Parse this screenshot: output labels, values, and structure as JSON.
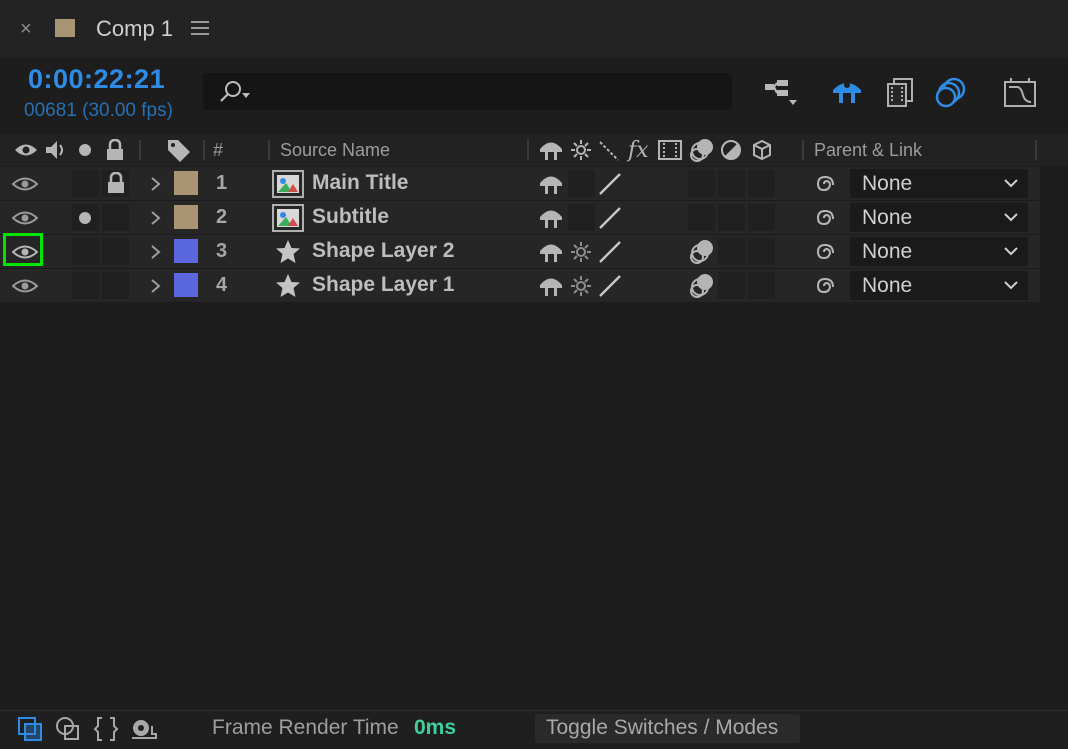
{
  "tab": {
    "close": "×",
    "title": "Comp 1"
  },
  "header": {
    "timecode": "0:00:22:21",
    "frames": "00681 (30.00 fps)",
    "search_placeholder": ""
  },
  "columns": {
    "number": "#",
    "source_name": "Source Name",
    "parent_link": "Parent & Link"
  },
  "layers": [
    {
      "num": "1",
      "name": "Main Title",
      "type": "footage",
      "label_color": "#a99473",
      "locked": true,
      "solo": false,
      "video": true,
      "highlighted": false,
      "parent": "None"
    },
    {
      "num": "2",
      "name": "Subtitle",
      "type": "footage",
      "label_color": "#a99473",
      "locked": false,
      "solo": true,
      "video": true,
      "highlighted": false,
      "parent": "None"
    },
    {
      "num": "3",
      "name": "Shape Layer 2",
      "type": "shape",
      "label_color": "#5b67df",
      "locked": false,
      "solo": false,
      "video": true,
      "highlighted": true,
      "parent": "None"
    },
    {
      "num": "4",
      "name": "Shape Layer 1",
      "type": "shape",
      "label_color": "#5b67df",
      "locked": false,
      "solo": false,
      "video": true,
      "highlighted": false,
      "parent": "None"
    }
  ],
  "footer": {
    "frame_render_label": "Frame Render Time",
    "frame_render_value": "0ms",
    "toggle_label": "Toggle Switches / Modes"
  },
  "colors": {
    "accent": "#2e8ce6",
    "highlight": "#00e600",
    "render_time": "#3fcf9a"
  }
}
